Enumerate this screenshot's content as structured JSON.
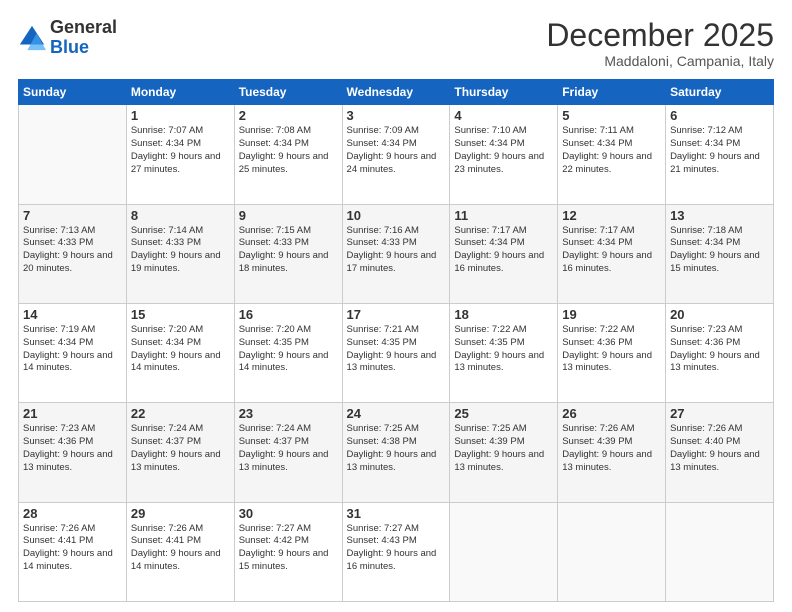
{
  "logo": {
    "general": "General",
    "blue": "Blue"
  },
  "header": {
    "month": "December 2025",
    "location": "Maddaloni, Campania, Italy"
  },
  "weekdays": [
    "Sunday",
    "Monday",
    "Tuesday",
    "Wednesday",
    "Thursday",
    "Friday",
    "Saturday"
  ],
  "weeks": [
    [
      {
        "day": "",
        "sunrise": "",
        "sunset": "",
        "daylight": ""
      },
      {
        "day": "1",
        "sunrise": "Sunrise: 7:07 AM",
        "sunset": "Sunset: 4:34 PM",
        "daylight": "Daylight: 9 hours and 27 minutes."
      },
      {
        "day": "2",
        "sunrise": "Sunrise: 7:08 AM",
        "sunset": "Sunset: 4:34 PM",
        "daylight": "Daylight: 9 hours and 25 minutes."
      },
      {
        "day": "3",
        "sunrise": "Sunrise: 7:09 AM",
        "sunset": "Sunset: 4:34 PM",
        "daylight": "Daylight: 9 hours and 24 minutes."
      },
      {
        "day": "4",
        "sunrise": "Sunrise: 7:10 AM",
        "sunset": "Sunset: 4:34 PM",
        "daylight": "Daylight: 9 hours and 23 minutes."
      },
      {
        "day": "5",
        "sunrise": "Sunrise: 7:11 AM",
        "sunset": "Sunset: 4:34 PM",
        "daylight": "Daylight: 9 hours and 22 minutes."
      },
      {
        "day": "6",
        "sunrise": "Sunrise: 7:12 AM",
        "sunset": "Sunset: 4:34 PM",
        "daylight": "Daylight: 9 hours and 21 minutes."
      }
    ],
    [
      {
        "day": "7",
        "sunrise": "Sunrise: 7:13 AM",
        "sunset": "Sunset: 4:33 PM",
        "daylight": "Daylight: 9 hours and 20 minutes."
      },
      {
        "day": "8",
        "sunrise": "Sunrise: 7:14 AM",
        "sunset": "Sunset: 4:33 PM",
        "daylight": "Daylight: 9 hours and 19 minutes."
      },
      {
        "day": "9",
        "sunrise": "Sunrise: 7:15 AM",
        "sunset": "Sunset: 4:33 PM",
        "daylight": "Daylight: 9 hours and 18 minutes."
      },
      {
        "day": "10",
        "sunrise": "Sunrise: 7:16 AM",
        "sunset": "Sunset: 4:33 PM",
        "daylight": "Daylight: 9 hours and 17 minutes."
      },
      {
        "day": "11",
        "sunrise": "Sunrise: 7:17 AM",
        "sunset": "Sunset: 4:34 PM",
        "daylight": "Daylight: 9 hours and 16 minutes."
      },
      {
        "day": "12",
        "sunrise": "Sunrise: 7:17 AM",
        "sunset": "Sunset: 4:34 PM",
        "daylight": "Daylight: 9 hours and 16 minutes."
      },
      {
        "day": "13",
        "sunrise": "Sunrise: 7:18 AM",
        "sunset": "Sunset: 4:34 PM",
        "daylight": "Daylight: 9 hours and 15 minutes."
      }
    ],
    [
      {
        "day": "14",
        "sunrise": "Sunrise: 7:19 AM",
        "sunset": "Sunset: 4:34 PM",
        "daylight": "Daylight: 9 hours and 14 minutes."
      },
      {
        "day": "15",
        "sunrise": "Sunrise: 7:20 AM",
        "sunset": "Sunset: 4:34 PM",
        "daylight": "Daylight: 9 hours and 14 minutes."
      },
      {
        "day": "16",
        "sunrise": "Sunrise: 7:20 AM",
        "sunset": "Sunset: 4:35 PM",
        "daylight": "Daylight: 9 hours and 14 minutes."
      },
      {
        "day": "17",
        "sunrise": "Sunrise: 7:21 AM",
        "sunset": "Sunset: 4:35 PM",
        "daylight": "Daylight: 9 hours and 13 minutes."
      },
      {
        "day": "18",
        "sunrise": "Sunrise: 7:22 AM",
        "sunset": "Sunset: 4:35 PM",
        "daylight": "Daylight: 9 hours and 13 minutes."
      },
      {
        "day": "19",
        "sunrise": "Sunrise: 7:22 AM",
        "sunset": "Sunset: 4:36 PM",
        "daylight": "Daylight: 9 hours and 13 minutes."
      },
      {
        "day": "20",
        "sunrise": "Sunrise: 7:23 AM",
        "sunset": "Sunset: 4:36 PM",
        "daylight": "Daylight: 9 hours and 13 minutes."
      }
    ],
    [
      {
        "day": "21",
        "sunrise": "Sunrise: 7:23 AM",
        "sunset": "Sunset: 4:36 PM",
        "daylight": "Daylight: 9 hours and 13 minutes."
      },
      {
        "day": "22",
        "sunrise": "Sunrise: 7:24 AM",
        "sunset": "Sunset: 4:37 PM",
        "daylight": "Daylight: 9 hours and 13 minutes."
      },
      {
        "day": "23",
        "sunrise": "Sunrise: 7:24 AM",
        "sunset": "Sunset: 4:37 PM",
        "daylight": "Daylight: 9 hours and 13 minutes."
      },
      {
        "day": "24",
        "sunrise": "Sunrise: 7:25 AM",
        "sunset": "Sunset: 4:38 PM",
        "daylight": "Daylight: 9 hours and 13 minutes."
      },
      {
        "day": "25",
        "sunrise": "Sunrise: 7:25 AM",
        "sunset": "Sunset: 4:39 PM",
        "daylight": "Daylight: 9 hours and 13 minutes."
      },
      {
        "day": "26",
        "sunrise": "Sunrise: 7:26 AM",
        "sunset": "Sunset: 4:39 PM",
        "daylight": "Daylight: 9 hours and 13 minutes."
      },
      {
        "day": "27",
        "sunrise": "Sunrise: 7:26 AM",
        "sunset": "Sunset: 4:40 PM",
        "daylight": "Daylight: 9 hours and 13 minutes."
      }
    ],
    [
      {
        "day": "28",
        "sunrise": "Sunrise: 7:26 AM",
        "sunset": "Sunset: 4:41 PM",
        "daylight": "Daylight: 9 hours and 14 minutes."
      },
      {
        "day": "29",
        "sunrise": "Sunrise: 7:26 AM",
        "sunset": "Sunset: 4:41 PM",
        "daylight": "Daylight: 9 hours and 14 minutes."
      },
      {
        "day": "30",
        "sunrise": "Sunrise: 7:27 AM",
        "sunset": "Sunset: 4:42 PM",
        "daylight": "Daylight: 9 hours and 15 minutes."
      },
      {
        "day": "31",
        "sunrise": "Sunrise: 7:27 AM",
        "sunset": "Sunset: 4:43 PM",
        "daylight": "Daylight: 9 hours and 16 minutes."
      },
      {
        "day": "",
        "sunrise": "",
        "sunset": "",
        "daylight": ""
      },
      {
        "day": "",
        "sunrise": "",
        "sunset": "",
        "daylight": ""
      },
      {
        "day": "",
        "sunrise": "",
        "sunset": "",
        "daylight": ""
      }
    ]
  ]
}
